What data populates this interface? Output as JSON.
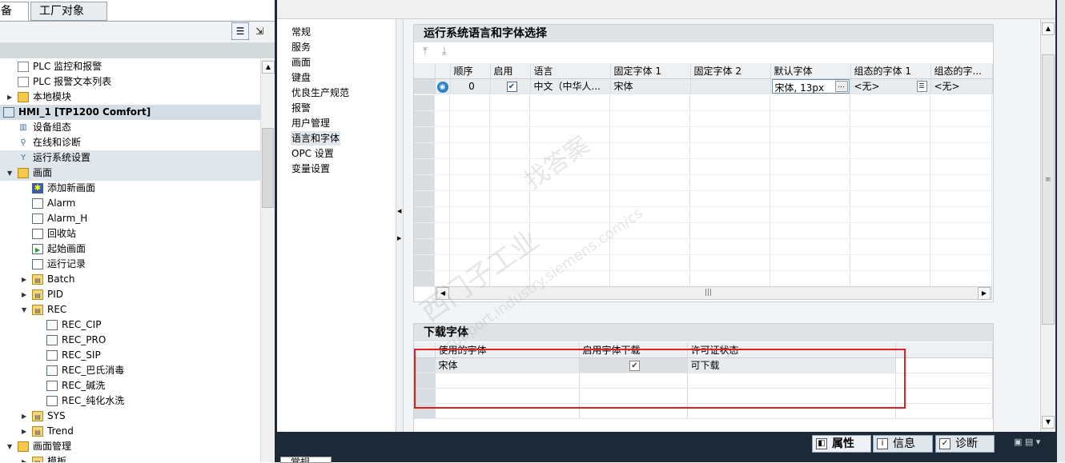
{
  "left_panel": {
    "tabs": [
      "备",
      "工厂对象"
    ],
    "tree": [
      {
        "label": "PLC 监控和报警",
        "icon": "doc-icon",
        "indent": 1
      },
      {
        "label": "PLC 报警文本列表",
        "icon": "doc-icon",
        "indent": 1
      },
      {
        "label": "本地模块",
        "icon": "folder-icon",
        "indent": 1,
        "expander": "▶"
      },
      {
        "label": "HMI_1 [TP1200 Comfort]",
        "icon": "device-icon",
        "indent": 0,
        "expander": "▼"
      },
      {
        "label": "设备组态",
        "icon": "config-icon",
        "indent": 1
      },
      {
        "label": "在线和诊断",
        "icon": "diag-icon",
        "indent": 1
      },
      {
        "label": "运行系统设置",
        "icon": "settings-icon",
        "indent": 1
      },
      {
        "label": "画面",
        "icon": "folder-icon",
        "indent": 1,
        "expander": "▼"
      },
      {
        "label": "添加新画面",
        "icon": "add-icon",
        "indent": 2
      },
      {
        "label": "Alarm",
        "icon": "screen-icon",
        "indent": 2
      },
      {
        "label": "Alarm_H",
        "icon": "screen-icon",
        "indent": 2
      },
      {
        "label": "回收站",
        "icon": "screen-icon",
        "indent": 2
      },
      {
        "label": "起始画面",
        "icon": "start-screen-icon",
        "indent": 2
      },
      {
        "label": "运行记录",
        "icon": "screen-icon",
        "indent": 2
      },
      {
        "label": "Batch",
        "icon": "folder-icon",
        "indent": 2,
        "expander": "▶"
      },
      {
        "label": "PID",
        "icon": "folder-icon",
        "indent": 2,
        "expander": "▶"
      },
      {
        "label": "REC",
        "icon": "folder-icon",
        "indent": 2,
        "expander": "▼"
      },
      {
        "label": "REC_CIP",
        "icon": "screen-icon",
        "indent": 3
      },
      {
        "label": "REC_PRO",
        "icon": "screen-icon",
        "indent": 3
      },
      {
        "label": "REC_SIP",
        "icon": "screen-icon",
        "indent": 3
      },
      {
        "label": "REC_巴氏消毒",
        "icon": "screen-icon",
        "indent": 3
      },
      {
        "label": "REC_碱洗",
        "icon": "screen-icon",
        "indent": 3
      },
      {
        "label": "REC_纯化水洗",
        "icon": "screen-icon",
        "indent": 3
      },
      {
        "label": "SYS",
        "icon": "folder-icon",
        "indent": 2,
        "expander": "▶"
      },
      {
        "label": "Trend",
        "icon": "folder-icon",
        "indent": 2,
        "expander": "▶"
      },
      {
        "label": "画面管理",
        "icon": "folder-icon",
        "indent": 1,
        "expander": "▼"
      },
      {
        "label": "模板",
        "icon": "folder-icon",
        "indent": 2,
        "expander": "▶"
      }
    ]
  },
  "nav": {
    "items": [
      "常规",
      "服务",
      "画面",
      "键盘",
      "优良生产规范",
      "报警",
      "用户管理",
      "语言和字体",
      "OPC 设置",
      "变量设置"
    ],
    "selected": 7
  },
  "lang_section": {
    "title": "运行系统语言和字体选择",
    "columns": [
      "顺序",
      "启用",
      "语言",
      "固定字体 1",
      "固定字体 2",
      "默认字体",
      "组态的字体 1",
      "组态的字..."
    ],
    "row": {
      "order": "0",
      "enabled": true,
      "language": "中文（中华人...",
      "fixed1": "宋体",
      "fixed2": "",
      "default_font": "宋体, 13px",
      "cfg1": "<无>",
      "cfg2": "<无>"
    }
  },
  "download_section": {
    "title": "下载字体",
    "columns": [
      "使用的字体",
      "启用字体下载",
      "许可证状态"
    ],
    "row": {
      "font": "宋体",
      "enabled": true,
      "license": "可下载"
    }
  },
  "bottom_tabs": [
    "属性",
    "信息",
    "诊断"
  ],
  "bottom_sub": "常规",
  "watermark": {
    "line1": "西门子工业",
    "line2": "找答案",
    "line3": "support.industry.siemens.com/cs"
  }
}
